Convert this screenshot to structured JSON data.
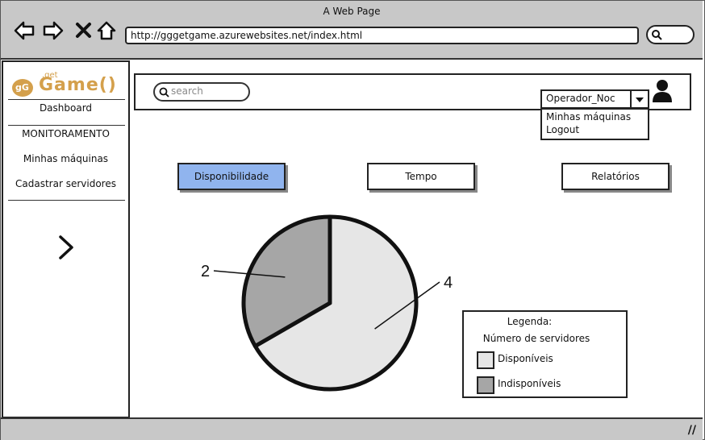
{
  "window": {
    "title": "A Web Page",
    "url": "http://gggetgame.azurewebsites.net/index.html"
  },
  "logo": {
    "prefix": "gG",
    "small": ".get",
    "name": "Game()"
  },
  "sidebar": {
    "items": [
      {
        "label": "Dashboard"
      },
      {
        "label": "MONITORAMENTO"
      },
      {
        "label": "Minhas máquinas"
      },
      {
        "label": "Cadastrar servidores"
      }
    ]
  },
  "search": {
    "placeholder": "search"
  },
  "user_menu": {
    "selected": "Operador_Noc",
    "options": [
      "Minhas máquinas",
      "Logout"
    ]
  },
  "tabs": [
    {
      "label": "Disponibilidade",
      "active": true
    },
    {
      "label": "Tempo",
      "active": false
    },
    {
      "label": "Relatórios",
      "active": false
    }
  ],
  "chart_data": {
    "type": "pie",
    "title": "",
    "slices": [
      {
        "name": "Disponíveis",
        "value": 4,
        "label": "4",
        "color": "#e6e6e6"
      },
      {
        "name": "Indisponíveis",
        "value": 2,
        "label": "2",
        "color": "#a6a6a6"
      }
    ],
    "legend": {
      "title": "Legenda:",
      "subtitle": "Número de servidores",
      "placement": "bottom-right"
    }
  },
  "colors": {
    "active_tab": "#90b4ee",
    "chrome": "#c8c8c8"
  }
}
